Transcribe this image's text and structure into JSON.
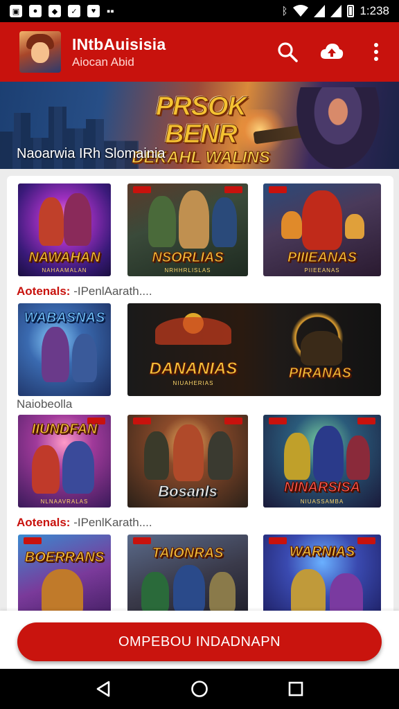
{
  "status_bar": {
    "time": "1:238",
    "left_icons": [
      "gallery-icon",
      "circle-app-icon",
      "tag-icon",
      "check-app-icon",
      "shield-app-icon",
      "message-icon"
    ],
    "right_icons": [
      "bluetooth-icon",
      "wifi-icon",
      "signal-icon",
      "signal-icon",
      "battery-icon"
    ]
  },
  "app_bar": {
    "title": "INtbAuisisia",
    "subtitle": "Aiocan Abid",
    "actions": [
      "search-icon",
      "cloud-upload-icon",
      "more-vert-icon"
    ]
  },
  "banner": {
    "logo_line1": "PRSOK BENR",
    "logo_line2": "DEKAHL WALINS",
    "caption": "Naoarwia IRh Slomainia"
  },
  "grid": {
    "rows": [
      {
        "tiles": [
          {
            "title": "NAWAHAN",
            "sub": "NAHAAMALAN"
          },
          {
            "title": "NSORLIAS",
            "sub": "NRHHRLISLAS"
          },
          {
            "title": "PIIIEANAS",
            "sub": "PIIEEANAS"
          }
        ]
      },
      {
        "tiles": [
          {
            "title": "WABASNAS",
            "sub": ""
          },
          {
            "title": "DANANIAS",
            "sub": "NIUAHERIAS"
          },
          {
            "title": "PIRANAS",
            "sub": ""
          }
        ]
      },
      {
        "tiles": [
          {
            "title": "IIUNDFAN",
            "sub": "NLNAAVRALAS"
          },
          {
            "title": "Bosanls",
            "sub": ""
          },
          {
            "title": "NINARSISA",
            "sub": "NIUASSAMBA"
          }
        ]
      },
      {
        "tiles": [
          {
            "title": "BOERRANS",
            "sub": ""
          },
          {
            "title": "TAIONRAS",
            "sub": ""
          },
          {
            "title": "WARNIAS",
            "sub": ""
          }
        ]
      }
    ],
    "section_labels": [
      {
        "highlight": "Aotenals:",
        "text": " -IPenlAarath...."
      },
      {
        "highlight": "",
        "text": "Naiobeolla"
      },
      {
        "highlight": "Aotenals:",
        "text": " -IPenlKarath...."
      }
    ]
  },
  "cta": {
    "label": "OMPEBOU INDADNAPN"
  },
  "nav_bar": {
    "buttons": [
      "back-icon",
      "home-icon",
      "recents-icon"
    ]
  },
  "colors": {
    "primary": "#c8120d",
    "title_gold": "#f7c53c"
  }
}
